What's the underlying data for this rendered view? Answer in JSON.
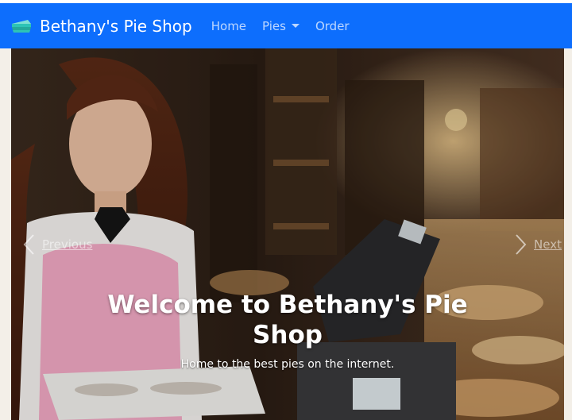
{
  "brand": {
    "name": "Bethany's Pie Shop",
    "logo_icon": "pie-slice-icon"
  },
  "nav": {
    "home": "Home",
    "pies": "Pies",
    "order": "Order"
  },
  "carousel": {
    "prev_label": "Previous",
    "next_label": "Next",
    "prev_icon": "chevron-left-icon",
    "next_icon": "chevron-right-icon",
    "caption_title": "Welcome to Bethany's Pie Shop",
    "caption_text": "Home to the best pies on the internet."
  },
  "colors": {
    "navbar": "#0d6efd",
    "brand_logo": "#2ec4b6"
  }
}
